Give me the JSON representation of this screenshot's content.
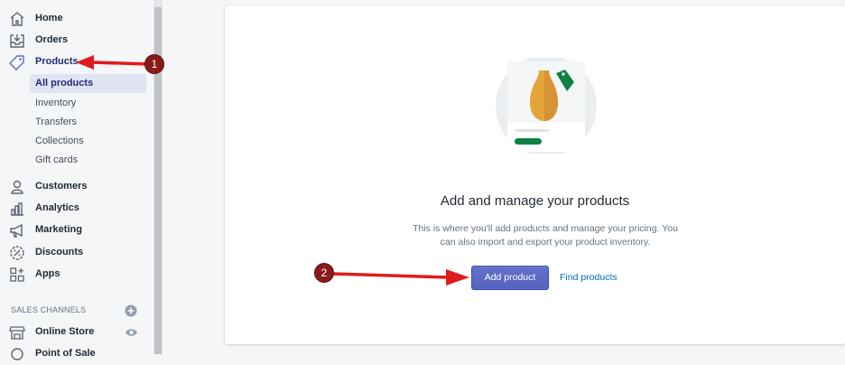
{
  "sidebar": {
    "items": [
      {
        "label": "Home",
        "icon": "home-icon"
      },
      {
        "label": "Orders",
        "icon": "orders-icon"
      },
      {
        "label": "Products",
        "icon": "tag-icon"
      },
      {
        "label": "Customers",
        "icon": "customer-icon"
      },
      {
        "label": "Analytics",
        "icon": "analytics-icon"
      },
      {
        "label": "Marketing",
        "icon": "megaphone-icon"
      },
      {
        "label": "Discounts",
        "icon": "discount-icon"
      },
      {
        "label": "Apps",
        "icon": "apps-icon"
      }
    ],
    "products_sub": [
      {
        "label": "All products"
      },
      {
        "label": "Inventory"
      },
      {
        "label": "Transfers"
      },
      {
        "label": "Collections"
      },
      {
        "label": "Gift cards"
      }
    ],
    "sales_channels_heading": "SALES CHANNELS",
    "channels": [
      {
        "label": "Online Store",
        "icon": "store-icon"
      },
      {
        "label": "Point of Sale",
        "icon": "pos-icon"
      }
    ]
  },
  "main": {
    "title": "Add and manage your products",
    "description": "This is where you'll add products and manage your pricing. You can also import and export your product inventory.",
    "primary_button": "Add product",
    "secondary_link": "Find products"
  },
  "annotations": {
    "badge_1": "1",
    "badge_2": "2",
    "arrow_color": "#e01b1b",
    "badge_color": "#8b1a1a"
  },
  "colors": {
    "accent": "#5c6ac4",
    "link": "#006fbb",
    "illustration_vase": "#e3a53a",
    "illustration_tag": "#108043"
  }
}
